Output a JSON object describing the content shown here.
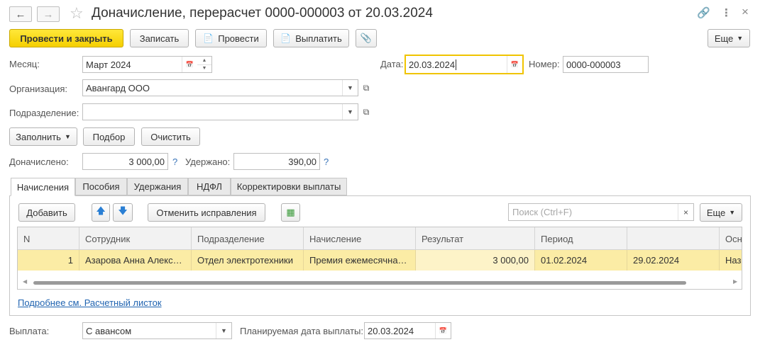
{
  "window": {
    "title": "Доначисление, перерасчет 0000-000003 от 20.03.2024"
  },
  "toolbar": {
    "post_close": "Провести и закрыть",
    "write": "Записать",
    "post": "Провести",
    "pay": "Выплатить",
    "more": "Еще"
  },
  "header": {
    "month_label": "Месяц:",
    "month_value": "Март 2024",
    "date_label": "Дата:",
    "date_value": "20.03.2024",
    "number_label": "Номер:",
    "number_value": "0000-000003",
    "org_label": "Организация:",
    "org_value": "Авангард ООО",
    "dept_label": "Подразделение:",
    "dept_value": ""
  },
  "actions": {
    "fill": "Заполнить",
    "select": "Подбор",
    "clear": "Очистить"
  },
  "totals": {
    "accrued_label": "Доначислено:",
    "accrued_value": "3 000,00",
    "withheld_label": "Удержано:",
    "withheld_value": "390,00",
    "help": "?"
  },
  "tabs": [
    {
      "label": "Начисления",
      "active": true
    },
    {
      "label": "Пособия",
      "active": false
    },
    {
      "label": "Удержания",
      "active": false
    },
    {
      "label": "НДФЛ",
      "active": false
    },
    {
      "label": "Корректировки выплаты",
      "active": false
    }
  ],
  "table_toolbar": {
    "add": "Добавить",
    "cancel_fix": "Отменить исправления",
    "search_placeholder": "Поиск (Ctrl+F)",
    "more": "Еще"
  },
  "table": {
    "columns": [
      "N",
      "Сотрудник",
      "Подразделение",
      "Начисление",
      "Результат",
      "Период",
      "",
      "Осн"
    ],
    "rows": [
      [
        "1",
        "Азарова Анна Алекс…",
        "Отдел электротехники",
        "Премия ежемесячна…",
        "3 000,00",
        "01.02.2024",
        "29.02.2024",
        "Назн"
      ]
    ]
  },
  "footer": {
    "payslip_link": "Подробнее см. Расчетный листок",
    "payout_label": "Выплата:",
    "payout_value": "С авансом",
    "planned_date_label": "Планируемая дата выплаты:",
    "planned_date_value": "20.03.2024"
  },
  "colors": {
    "primary_button": "#f5cf00",
    "selected_row": "#fbeca5",
    "focus_border": "#f0c400",
    "link": "#1f63b0"
  }
}
